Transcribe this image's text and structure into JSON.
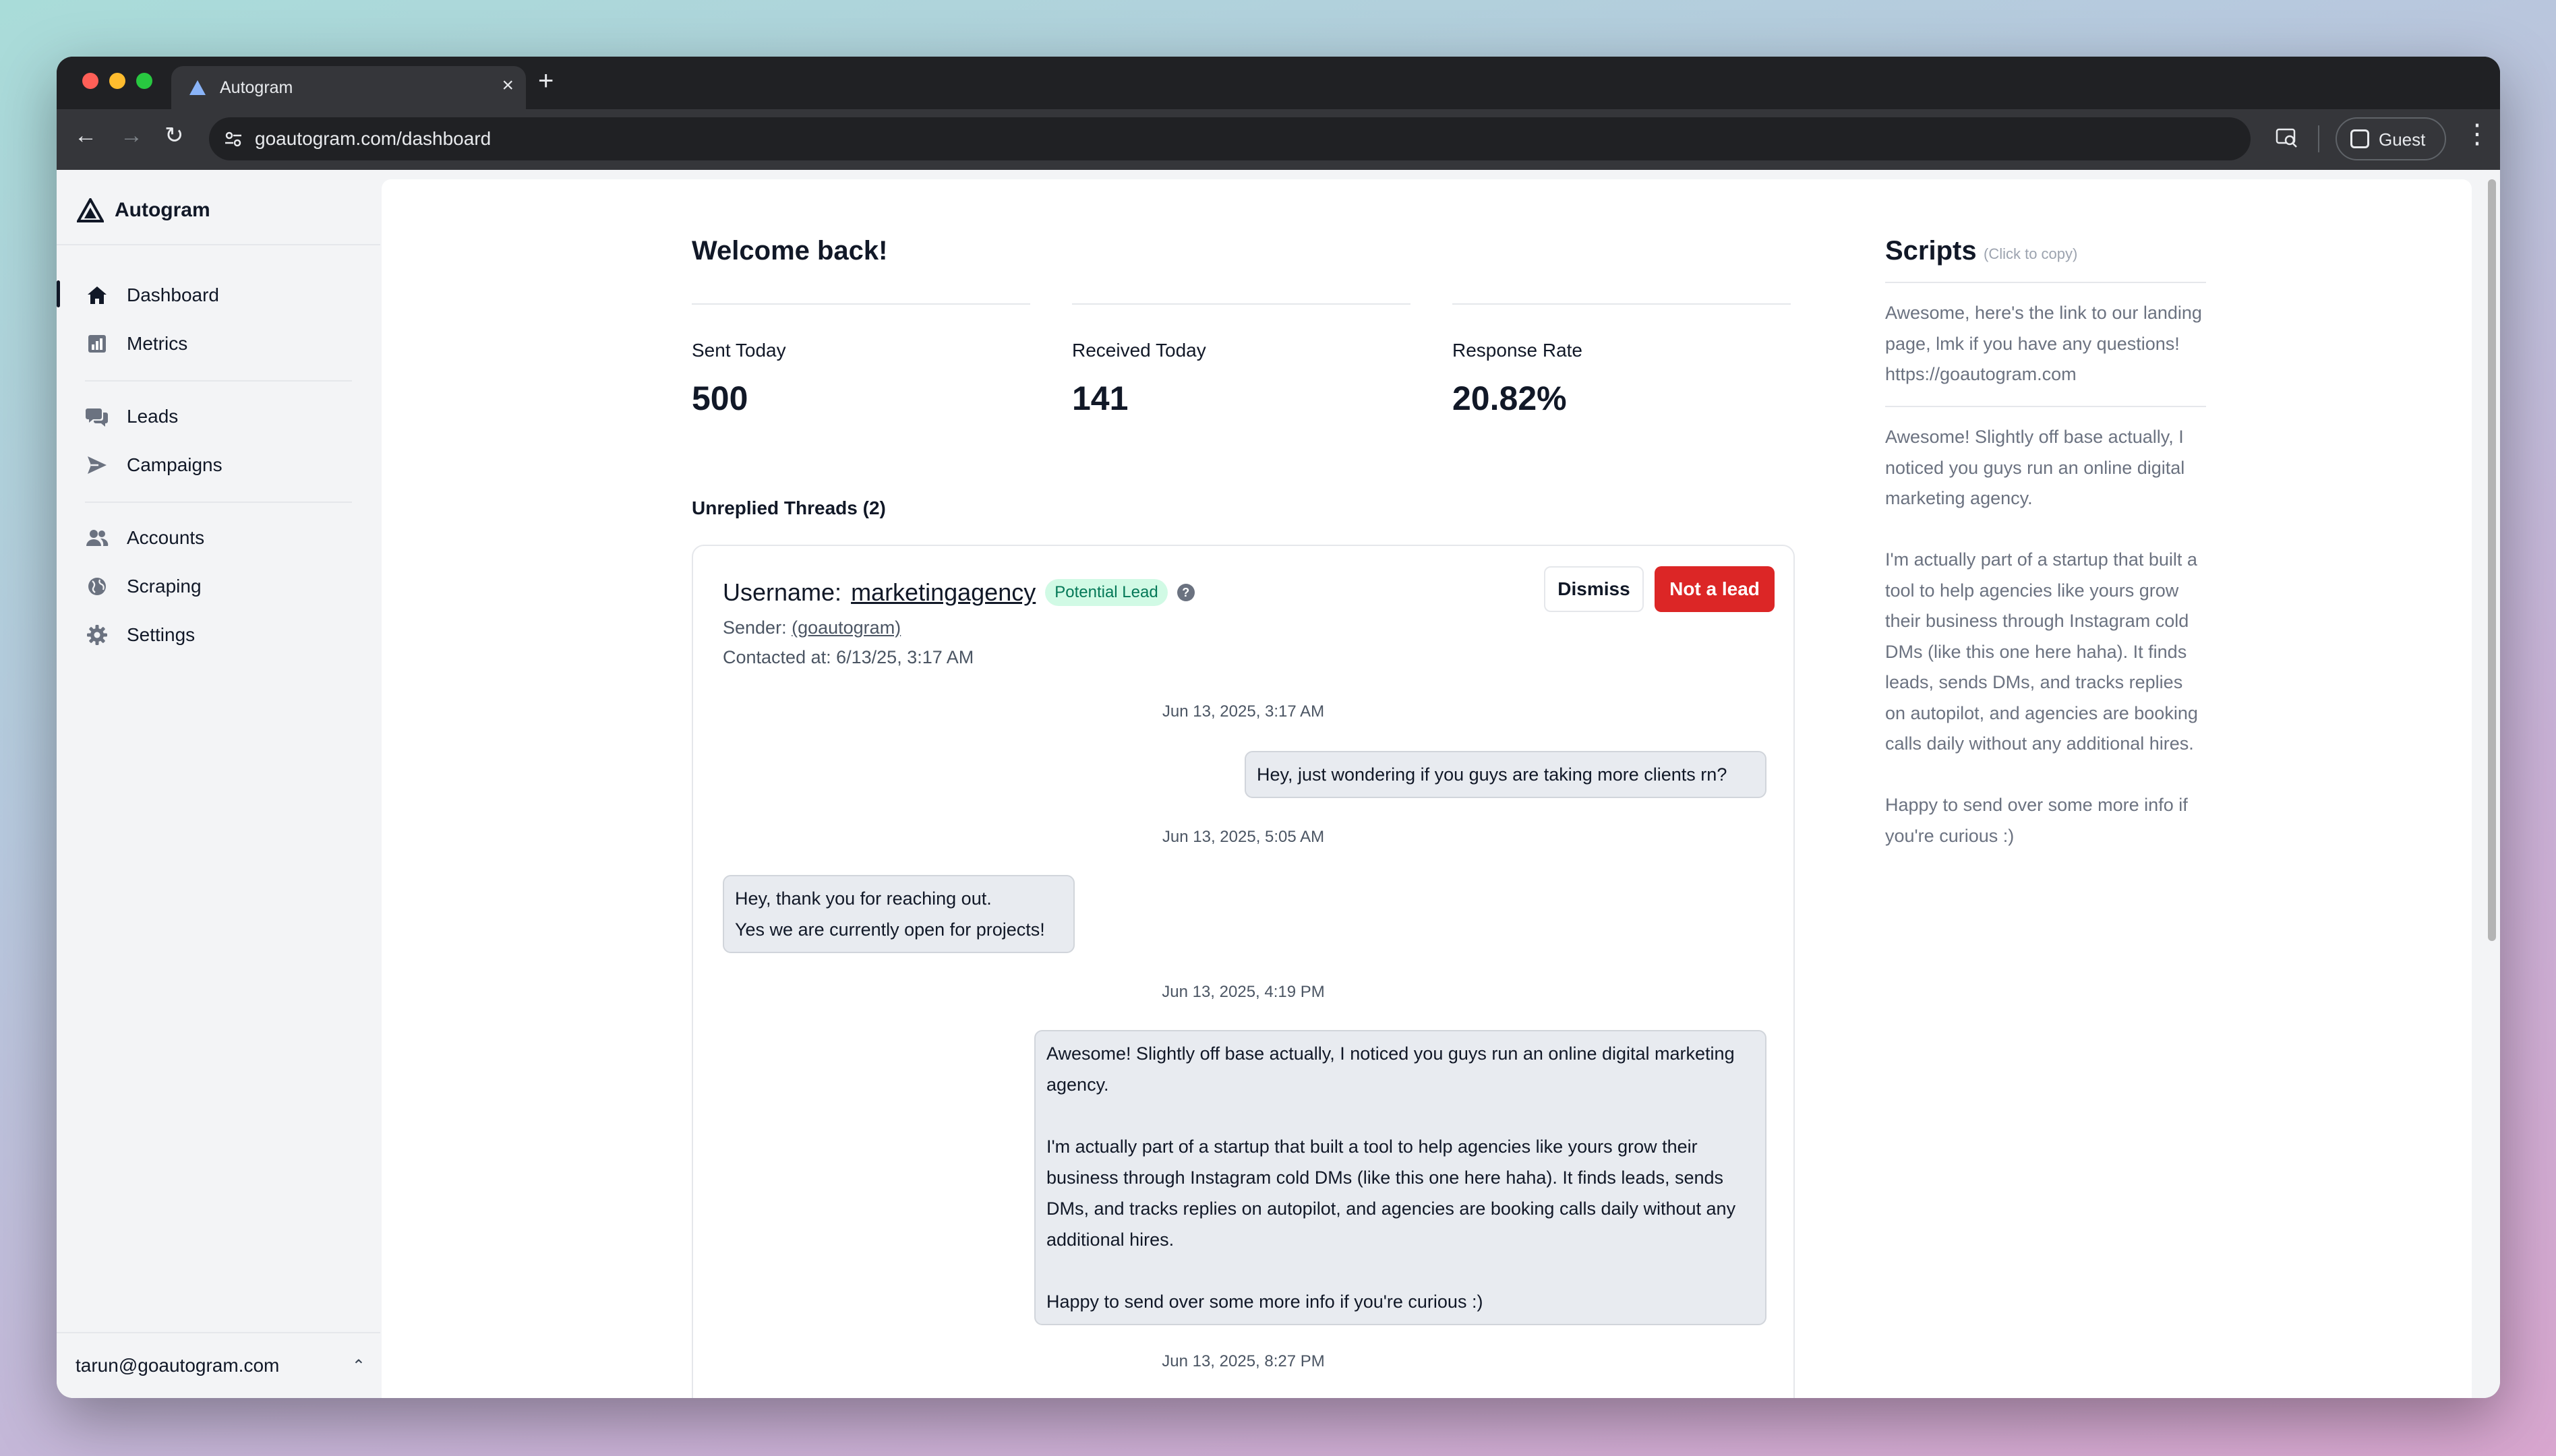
{
  "browser": {
    "tab_title": "Autogram",
    "url": "goautogram.com/dashboard",
    "profile_label": "Guest"
  },
  "app": {
    "name": "Autogram"
  },
  "sidebar": {
    "items": [
      {
        "label": "Dashboard",
        "icon": "home-icon"
      },
      {
        "label": "Metrics",
        "icon": "bar-chart-icon"
      },
      {
        "label": "Leads",
        "icon": "chat-bubbles-icon"
      },
      {
        "label": "Campaigns",
        "icon": "send-icon"
      },
      {
        "label": "Accounts",
        "icon": "users-icon"
      },
      {
        "label": "Scraping",
        "icon": "globe-icon"
      },
      {
        "label": "Settings",
        "icon": "gear-icon"
      }
    ],
    "user_email": "tarun@goautogram.com"
  },
  "main": {
    "welcome": "Welcome back!",
    "stats": [
      {
        "label": "Sent Today",
        "value": "500"
      },
      {
        "label": "Received Today",
        "value": "141"
      },
      {
        "label": "Response Rate",
        "value": "20.82%"
      }
    ],
    "unreplied_title": "Unreplied Threads (2)",
    "thread": {
      "username_label": "Username:",
      "username": "marketingagency",
      "badge": "Potential Lead",
      "sender_label": "Sender:",
      "sender_handle": "(goautogram)",
      "contacted": "Contacted at: 6/13/25, 3:17 AM",
      "dismiss_label": "Dismiss",
      "not_lead_label": "Not a lead",
      "messages": [
        {
          "timestamp": "Jun 13, 2025, 3:17 AM",
          "text": "Hey, just wondering if you guys are taking more clients rn?",
          "side": "right"
        },
        {
          "timestamp": "Jun 13, 2025, 5:05 AM",
          "text": "Hey, thank you for reaching out.\nYes we are currently open for projects!",
          "side": "left"
        },
        {
          "timestamp": "Jun 13, 2025, 4:19 PM",
          "text": "Awesome! Slightly off base actually, I noticed you guys run an online digital marketing agency.\n\nI'm actually part of a startup that built a tool to help agencies like yours grow their business through Instagram cold DMs (like this one here haha). It finds leads, sends DMs, and tracks replies on autopilot, and agencies are booking calls daily without any additional hires.\n\nHappy to send over some more info if you're curious :)",
          "side": "right"
        },
        {
          "timestamp": "Jun 13, 2025, 8:27 PM"
        }
      ]
    }
  },
  "scripts": {
    "title": "Scripts",
    "hint": "(Click to copy)",
    "items": [
      "Awesome, here's the link to our landing page, lmk if you have any questions! https://goautogram.com",
      "Awesome! Slightly off base actually, I noticed you guys run an online digital marketing agency.\n\nI'm actually part of a startup that built a tool to help agencies like yours grow their business through Instagram cold DMs (like this one here haha). It finds leads, sends DMs, and tracks replies on autopilot, and agencies are booking calls daily without any additional hires.\n\nHappy to send over some more info if you're curious :)"
    ]
  },
  "colors": {
    "primary_text": "#111827",
    "danger": "#dc2626",
    "badge_bg": "#d1fae5",
    "badge_text": "#047857",
    "bubble_bg": "#e8ebf0"
  }
}
